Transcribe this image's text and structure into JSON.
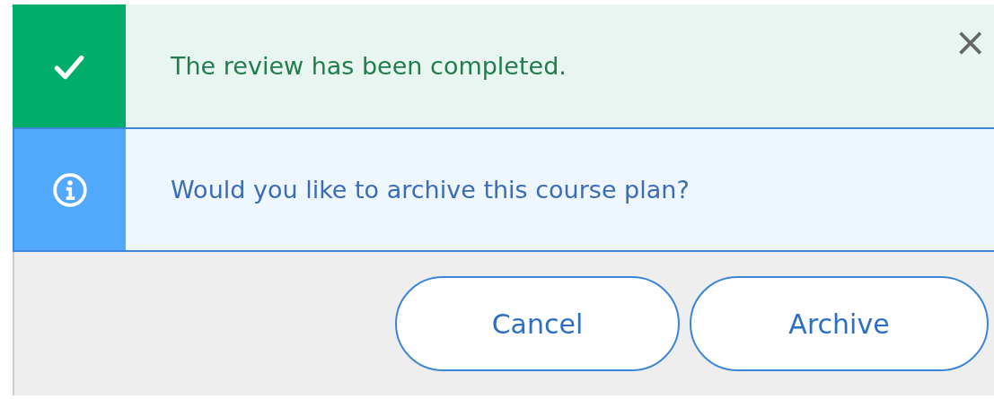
{
  "alerts": [
    {
      "kind": "success",
      "message": "The review has been completed.",
      "close": "×"
    },
    {
      "kind": "info",
      "message": "Would you like to archive this course plan?"
    }
  ],
  "buttons": [
    "Cancel",
    "Archive"
  ]
}
